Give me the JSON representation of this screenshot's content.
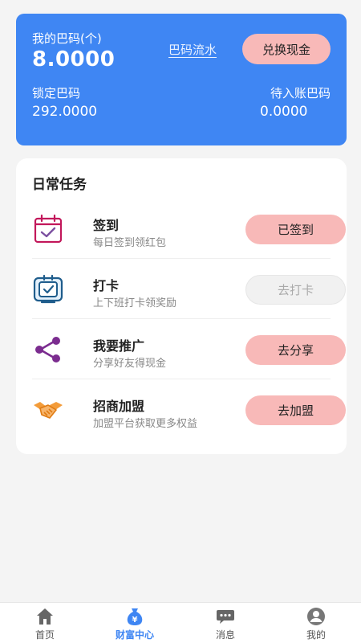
{
  "wallet": {
    "my_label": "我的巴码(个)",
    "my_amount": "8.0000",
    "flow_link": "巴码流水",
    "exchange_button": "兑换现金",
    "locked_label": "锁定巴码",
    "locked_amount": "292.0000",
    "pending_label": "待入账巴码",
    "pending_amount": "0.0000"
  },
  "tasks": {
    "title": "日常任务",
    "items": [
      {
        "name": "签到",
        "desc": "每日签到领红包",
        "button": "已签到",
        "icon": "calendar-check-icon"
      },
      {
        "name": "打卡",
        "desc": "上下班打卡领奖励",
        "button": "去打卡",
        "icon": "clock-in-icon"
      },
      {
        "name": "我要推广",
        "desc": "分享好友得现金",
        "button": "去分享",
        "icon": "share-icon"
      },
      {
        "name": "招商加盟",
        "desc": "加盟平台获取更多权益",
        "button": "去加盟",
        "icon": "handshake-icon"
      }
    ]
  },
  "tabbar": {
    "items": [
      {
        "label": "首页",
        "icon": "home-icon"
      },
      {
        "label": "财富中心",
        "icon": "money-bag-icon"
      },
      {
        "label": "消息",
        "icon": "chat-icon"
      },
      {
        "label": "我的",
        "icon": "user-icon"
      }
    ]
  },
  "colors": {
    "primary": "#3f86f3",
    "button_pink": "#f8b9b8",
    "background": "#f4f4f4"
  }
}
